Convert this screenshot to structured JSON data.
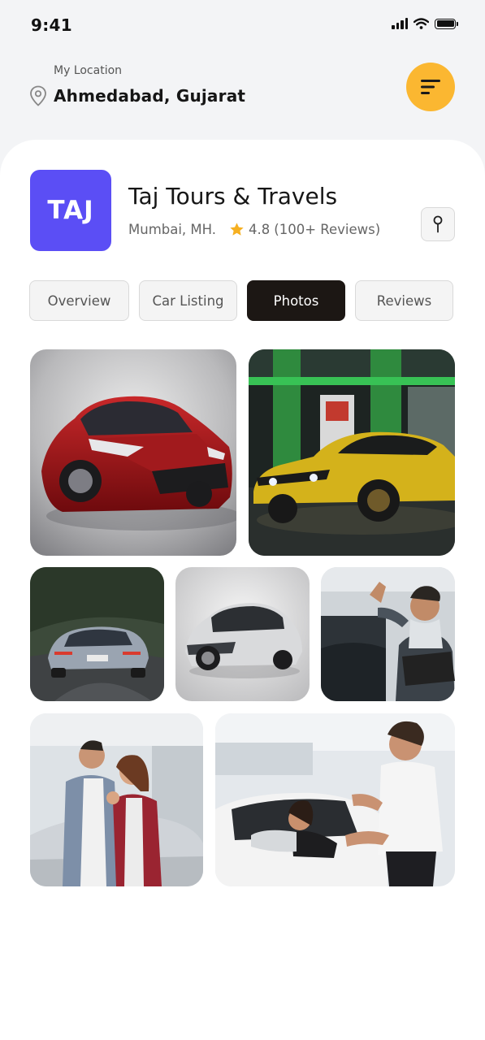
{
  "status_bar": {
    "time": "9:41"
  },
  "header": {
    "location_label": "My Location",
    "location_value": "Ahmedabad, Gujarat",
    "menu_icon": "menu-lines-icon",
    "accent_color": "#fbb731"
  },
  "business": {
    "logo_text": "TAJ",
    "logo_color": "#5b4ef5",
    "name": "Taj Tours & Travels",
    "city": "Mumbai, MH.",
    "rating": "4.8",
    "reviews": "(100+ Reviews)"
  },
  "tabs": [
    {
      "label": "Overview",
      "active": false
    },
    {
      "label": "Car Listing",
      "active": false
    },
    {
      "label": "Photos",
      "active": true
    },
    {
      "label": "Reviews",
      "active": false
    }
  ],
  "photos": [
    {
      "name": "red hatchback studio"
    },
    {
      "name": "yellow sedan at fuel station"
    },
    {
      "name": "grey sedan on forest road"
    },
    {
      "name": "silver hatchback studio"
    },
    {
      "name": "man holding car keys"
    },
    {
      "name": "couple holding car keys"
    },
    {
      "name": "handing keys to woman in car"
    }
  ]
}
